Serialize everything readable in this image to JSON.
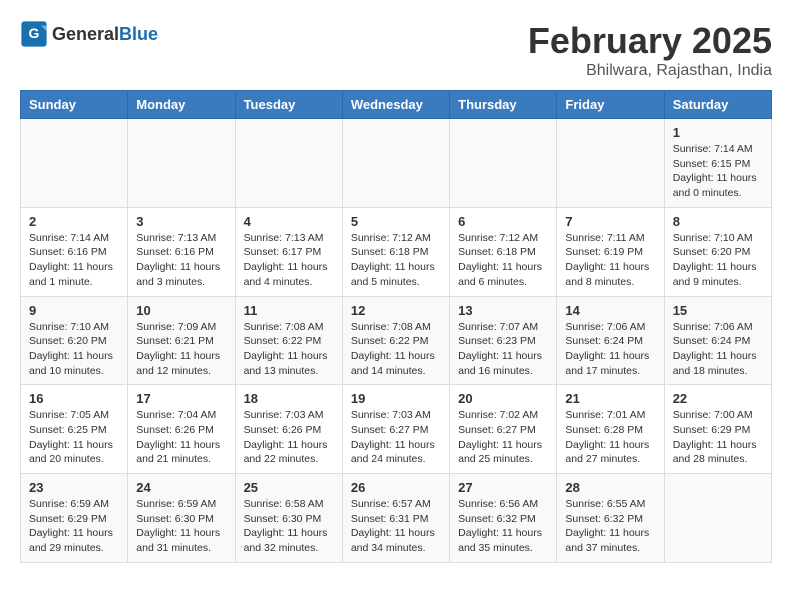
{
  "logo": {
    "general": "General",
    "blue": "Blue"
  },
  "title": "February 2025",
  "subtitle": "Bhilwara, Rajasthan, India",
  "days_of_week": [
    "Sunday",
    "Monday",
    "Tuesday",
    "Wednesday",
    "Thursday",
    "Friday",
    "Saturday"
  ],
  "weeks": [
    [
      {
        "day": "",
        "info": ""
      },
      {
        "day": "",
        "info": ""
      },
      {
        "day": "",
        "info": ""
      },
      {
        "day": "",
        "info": ""
      },
      {
        "day": "",
        "info": ""
      },
      {
        "day": "",
        "info": ""
      },
      {
        "day": "1",
        "info": "Sunrise: 7:14 AM\nSunset: 6:15 PM\nDaylight: 11 hours\nand 0 minutes."
      }
    ],
    [
      {
        "day": "2",
        "info": "Sunrise: 7:14 AM\nSunset: 6:16 PM\nDaylight: 11 hours\nand 1 minute."
      },
      {
        "day": "3",
        "info": "Sunrise: 7:13 AM\nSunset: 6:16 PM\nDaylight: 11 hours\nand 3 minutes."
      },
      {
        "day": "4",
        "info": "Sunrise: 7:13 AM\nSunset: 6:17 PM\nDaylight: 11 hours\nand 4 minutes."
      },
      {
        "day": "5",
        "info": "Sunrise: 7:12 AM\nSunset: 6:18 PM\nDaylight: 11 hours\nand 5 minutes."
      },
      {
        "day": "6",
        "info": "Sunrise: 7:12 AM\nSunset: 6:18 PM\nDaylight: 11 hours\nand 6 minutes."
      },
      {
        "day": "7",
        "info": "Sunrise: 7:11 AM\nSunset: 6:19 PM\nDaylight: 11 hours\nand 8 minutes."
      },
      {
        "day": "8",
        "info": "Sunrise: 7:10 AM\nSunset: 6:20 PM\nDaylight: 11 hours\nand 9 minutes."
      }
    ],
    [
      {
        "day": "9",
        "info": "Sunrise: 7:10 AM\nSunset: 6:20 PM\nDaylight: 11 hours\nand 10 minutes."
      },
      {
        "day": "10",
        "info": "Sunrise: 7:09 AM\nSunset: 6:21 PM\nDaylight: 11 hours\nand 12 minutes."
      },
      {
        "day": "11",
        "info": "Sunrise: 7:08 AM\nSunset: 6:22 PM\nDaylight: 11 hours\nand 13 minutes."
      },
      {
        "day": "12",
        "info": "Sunrise: 7:08 AM\nSunset: 6:22 PM\nDaylight: 11 hours\nand 14 minutes."
      },
      {
        "day": "13",
        "info": "Sunrise: 7:07 AM\nSunset: 6:23 PM\nDaylight: 11 hours\nand 16 minutes."
      },
      {
        "day": "14",
        "info": "Sunrise: 7:06 AM\nSunset: 6:24 PM\nDaylight: 11 hours\nand 17 minutes."
      },
      {
        "day": "15",
        "info": "Sunrise: 7:06 AM\nSunset: 6:24 PM\nDaylight: 11 hours\nand 18 minutes."
      }
    ],
    [
      {
        "day": "16",
        "info": "Sunrise: 7:05 AM\nSunset: 6:25 PM\nDaylight: 11 hours\nand 20 minutes."
      },
      {
        "day": "17",
        "info": "Sunrise: 7:04 AM\nSunset: 6:26 PM\nDaylight: 11 hours\nand 21 minutes."
      },
      {
        "day": "18",
        "info": "Sunrise: 7:03 AM\nSunset: 6:26 PM\nDaylight: 11 hours\nand 22 minutes."
      },
      {
        "day": "19",
        "info": "Sunrise: 7:03 AM\nSunset: 6:27 PM\nDaylight: 11 hours\nand 24 minutes."
      },
      {
        "day": "20",
        "info": "Sunrise: 7:02 AM\nSunset: 6:27 PM\nDaylight: 11 hours\nand 25 minutes."
      },
      {
        "day": "21",
        "info": "Sunrise: 7:01 AM\nSunset: 6:28 PM\nDaylight: 11 hours\nand 27 minutes."
      },
      {
        "day": "22",
        "info": "Sunrise: 7:00 AM\nSunset: 6:29 PM\nDaylight: 11 hours\nand 28 minutes."
      }
    ],
    [
      {
        "day": "23",
        "info": "Sunrise: 6:59 AM\nSunset: 6:29 PM\nDaylight: 11 hours\nand 29 minutes."
      },
      {
        "day": "24",
        "info": "Sunrise: 6:59 AM\nSunset: 6:30 PM\nDaylight: 11 hours\nand 31 minutes."
      },
      {
        "day": "25",
        "info": "Sunrise: 6:58 AM\nSunset: 6:30 PM\nDaylight: 11 hours\nand 32 minutes."
      },
      {
        "day": "26",
        "info": "Sunrise: 6:57 AM\nSunset: 6:31 PM\nDaylight: 11 hours\nand 34 minutes."
      },
      {
        "day": "27",
        "info": "Sunrise: 6:56 AM\nSunset: 6:32 PM\nDaylight: 11 hours\nand 35 minutes."
      },
      {
        "day": "28",
        "info": "Sunrise: 6:55 AM\nSunset: 6:32 PM\nDaylight: 11 hours\nand 37 minutes."
      },
      {
        "day": "",
        "info": ""
      }
    ]
  ]
}
